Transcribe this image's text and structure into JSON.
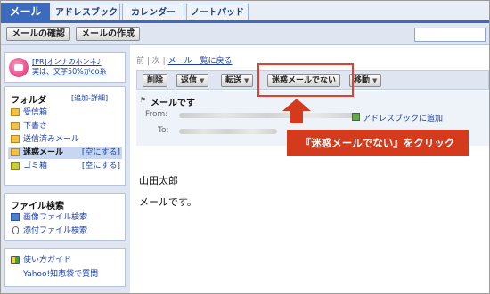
{
  "tabs": [
    "メール",
    "アドレスブック",
    "カレンダー",
    "ノートパッド"
  ],
  "toolbar": {
    "check_mail": "メールの確認",
    "compose": "メールの作成"
  },
  "sidebar": {
    "promo": {
      "line1": "[PR]オンナのホンネ♪",
      "line2": "実は、文字50%がoo系"
    },
    "folders_title": "フォルダ",
    "folders_links": "[追加-詳細]",
    "folders": [
      {
        "label": "受信箱",
        "icon": "inbox-folder-icon"
      },
      {
        "label": "下書き",
        "icon": "drafts-folder-icon"
      },
      {
        "label": "送信済みメール",
        "icon": "sent-folder-icon"
      },
      {
        "label": "迷惑メール",
        "icon": "spam-folder-icon",
        "selected": true,
        "action": "[空にする]"
      },
      {
        "label": "ゴミ箱",
        "icon": "trash-icon",
        "action": "[空にする]"
      }
    ],
    "file_search_title": "ファイル検索",
    "file_search": [
      "画像ファイル検索",
      "添付ファイル検索"
    ],
    "help": [
      "使い方ガイド",
      "Yahoo!知恵袋で質問"
    ]
  },
  "main": {
    "nav_prev_next": "前 | 次 |",
    "back_to_list": "メール一覧に戻る",
    "actions": {
      "delete": "削除",
      "reply": "返信",
      "forward": "転送",
      "not_spam": "迷惑メールでない",
      "move": "移動"
    },
    "subject": "メールです",
    "from_label": "From:",
    "to_label": "To:",
    "add_to_addressbook": "アドレスブックに追加",
    "body_lines": [
      "山田太郎",
      "メールです。"
    ]
  },
  "callout": "『迷惑メールでない』をクリック",
  "colors": {
    "accent": "#3b6bbf",
    "callout": "#d43a1c",
    "highlight_border": "#e1412c"
  }
}
